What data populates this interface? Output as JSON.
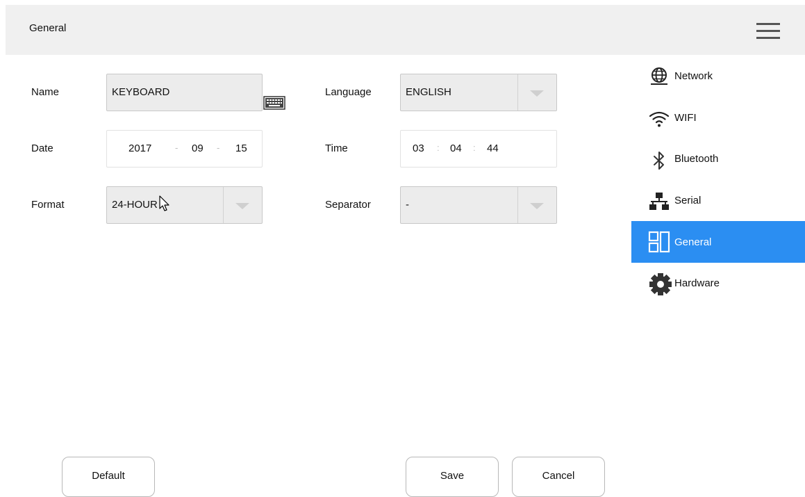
{
  "header": {
    "title": "General"
  },
  "form": {
    "name_label": "Name",
    "name_value": "KEYBOARD",
    "language_label": "Language",
    "language_value": "ENGLISH",
    "date_label": "Date",
    "date_year": "2017",
    "date_month": "09",
    "date_day": "15",
    "date_separator": "-",
    "time_label": "Time",
    "time_hour": "03",
    "time_minute": "04",
    "time_second": "44",
    "time_separator": ":",
    "format_label": "Format",
    "format_value": "24-HOUR",
    "separator_label": "Separator",
    "separator_value": "-"
  },
  "sidebar": {
    "items": [
      {
        "label": "Network",
        "icon": "globe-icon"
      },
      {
        "label": "WIFI",
        "icon": "wifi-icon"
      },
      {
        "label": "Bluetooth",
        "icon": "bluetooth-icon"
      },
      {
        "label": "Serial",
        "icon": "network-tree-icon"
      },
      {
        "label": "General",
        "icon": "layout-icon",
        "active": true
      },
      {
        "label": "Hardware",
        "icon": "gear-icon"
      }
    ]
  },
  "buttons": {
    "default_label": "Default",
    "save_label": "Save",
    "cancel_label": "Cancel"
  },
  "colors": {
    "active_nav": "#2b8ef2",
    "topbar_bg": "#f0f0f0",
    "input_grey": "#ececec"
  }
}
